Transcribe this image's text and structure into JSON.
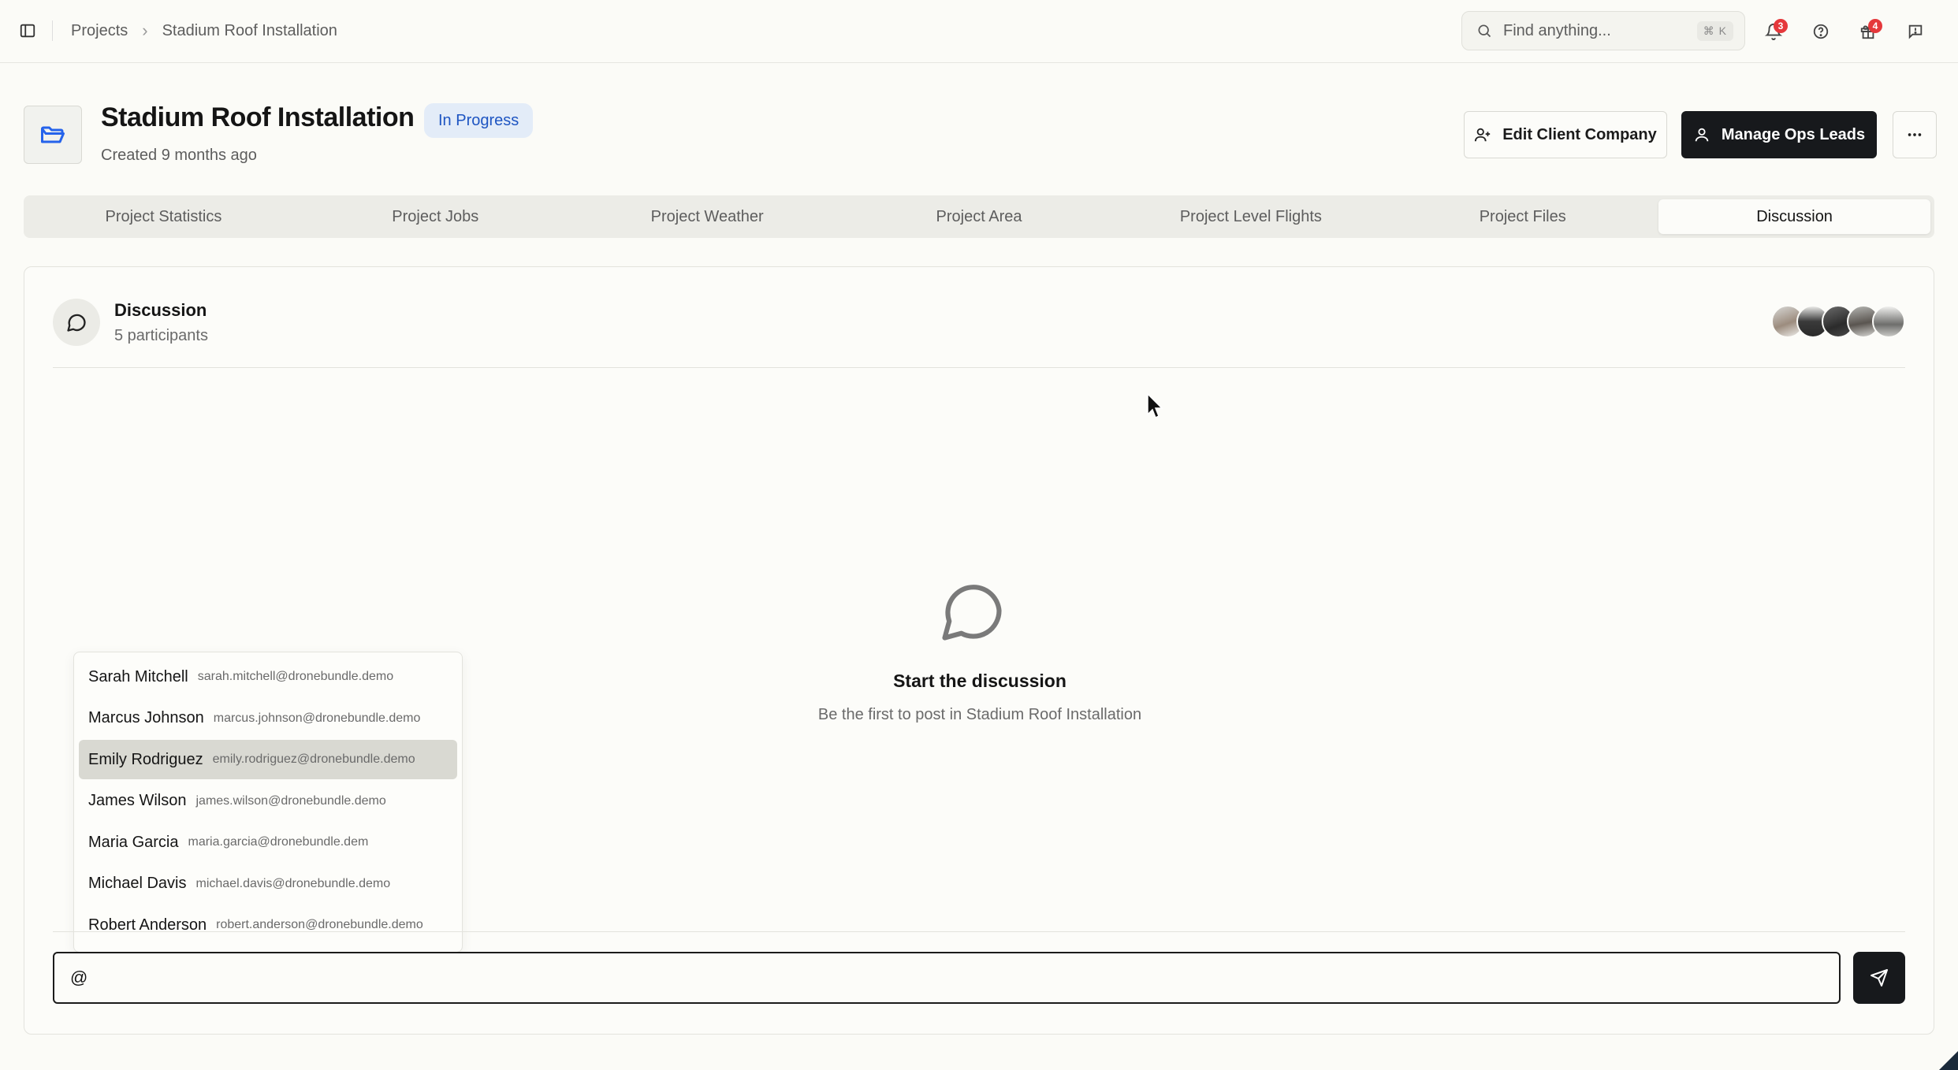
{
  "breadcrumb": {
    "root": "Projects",
    "current": "Stadium Roof Installation"
  },
  "search": {
    "placeholder": "Find anything...",
    "shortcut": "⌘ K"
  },
  "topbar": {
    "notifications_count": "3",
    "gifts_count": "4"
  },
  "project": {
    "title": "Stadium Roof Installation",
    "status": "In Progress",
    "created": "Created 9 months ago"
  },
  "actions": {
    "edit_client": "Edit Client Company",
    "manage_ops": "Manage Ops Leads"
  },
  "tabs": [
    {
      "label": "Project Statistics"
    },
    {
      "label": "Project Jobs"
    },
    {
      "label": "Project Weather"
    },
    {
      "label": "Project Area"
    },
    {
      "label": "Project Level Flights"
    },
    {
      "label": "Project Files"
    },
    {
      "label": "Discussion",
      "active": true
    }
  ],
  "discussion": {
    "title": "Discussion",
    "participants": "5 participants",
    "empty_title": "Start the discussion",
    "empty_sub": "Be the first to post in Stadium Roof Installation",
    "input_value": "@"
  },
  "mentions": [
    {
      "name": "Sarah Mitchell",
      "email": "sarah.mitchell@dronebundle.demo"
    },
    {
      "name": "Marcus Johnson",
      "email": "marcus.johnson@dronebundle.demo"
    },
    {
      "name": "Emily Rodriguez",
      "email": "emily.rodriguez@dronebundle.demo",
      "highlighted": true
    },
    {
      "name": "James Wilson",
      "email": "james.wilson@dronebundle.demo"
    },
    {
      "name": "Maria Garcia",
      "email": "maria.garcia@dronebundle.dem"
    },
    {
      "name": "Michael Davis",
      "email": "michael.davis@dronebundle.demo"
    },
    {
      "name": "Robert Anderson",
      "email": "robert.anderson@dronebundle.demo"
    }
  ],
  "colors": {
    "accent_dark": "#17191c",
    "status_bg": "#e3ecf8",
    "status_text": "#1e55c2",
    "badge_red": "#e5383b"
  }
}
